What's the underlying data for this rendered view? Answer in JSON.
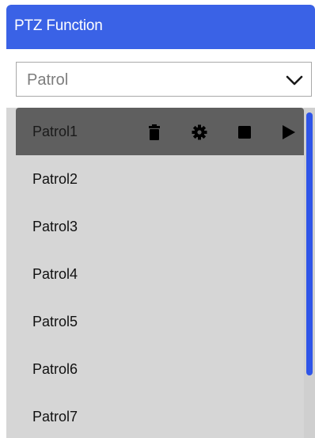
{
  "panel": {
    "title": "PTZ Function"
  },
  "selector": {
    "value": "Patrol",
    "icon": "chevron-down-icon"
  },
  "patrols": {
    "items": [
      {
        "label": "Patrol1",
        "selected": true
      },
      {
        "label": "Patrol2",
        "selected": false
      },
      {
        "label": "Patrol3",
        "selected": false
      },
      {
        "label": "Patrol4",
        "selected": false
      },
      {
        "label": "Patrol5",
        "selected": false
      },
      {
        "label": "Patrol6",
        "selected": false
      },
      {
        "label": "Patrol7",
        "selected": false
      }
    ],
    "actions": [
      "delete-icon",
      "settings-gear-icon",
      "stop-icon",
      "play-icon"
    ]
  },
  "colors": {
    "header": "#3a62e6",
    "selected_row": "#5f5f5f",
    "list_background": "#d6d6d6",
    "scroll_thumb": "#2f55e8"
  }
}
